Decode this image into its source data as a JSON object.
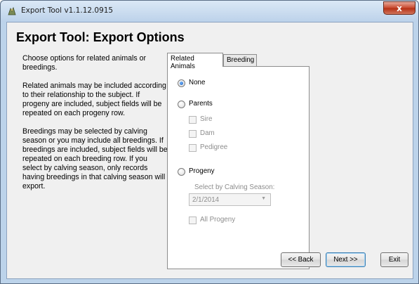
{
  "window": {
    "title": "Export Tool v1.1.12.0915",
    "close_glyph": "x"
  },
  "page": {
    "heading": "Export Tool:  Export Options"
  },
  "description": {
    "p1": "Choose options for related animals or breedings.",
    "p2": "Related animals may be included according to their relationship to the subject.  If progeny are included, subject fields will be repeated on each progeny row.",
    "p3": "Breedings may be selected by calving season or you may include all breedings.  If breedings are included, subject fields will be repeated on each breeding row.  If you select by calving season, only records having breedings in that calving season will export."
  },
  "tabs": [
    {
      "label": "Related Animals",
      "active": true
    },
    {
      "label": "Breeding",
      "active": false
    }
  ],
  "related": {
    "none_label": "None",
    "parents_label": "Parents",
    "sire_label": "Sire",
    "dam_label": "Dam",
    "pedigree_label": "Pedigree",
    "progeny_label": "Progeny",
    "season_label": "Select by Calving Season:",
    "season_value": "2/1/2014",
    "all_progeny_label": "All Progeny",
    "selected": "None"
  },
  "buttons": {
    "back": "<< Back",
    "next": "Next >>",
    "exit": "Exit"
  },
  "colors": {
    "accent": "#1f5fb8",
    "close": "#c7462c",
    "frame": "#bcd3ea"
  }
}
